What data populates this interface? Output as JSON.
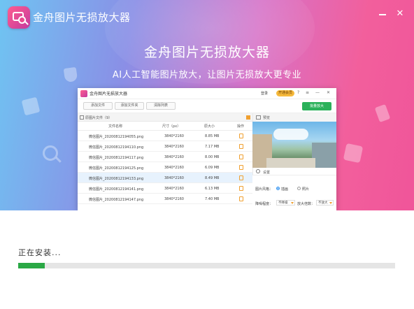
{
  "installer": {
    "app_title": "金舟图片无损放大器",
    "headline": "金舟图片无损放大器",
    "subline": "AI人工智能图片放大，让图片无损放大更专业",
    "minimize_icon": "minimize-icon",
    "close_icon": "close-icon",
    "close_glyph": "✕",
    "accent_color": "#2aa845"
  },
  "preview_app": {
    "title": "金舟图片无损放大器",
    "login": "登录",
    "vip": "开通会员",
    "window_controls": [
      "?",
      "≡",
      "—",
      "✕"
    ],
    "toolbar": {
      "add_file": "添加文件",
      "add_folder": "添加文件夹",
      "clear_list": "清除列表",
      "batch_enlarge": "批量放大"
    },
    "list_header": "原图片文件（9）",
    "columns": [
      "文件名称",
      "尺寸（px）",
      "原大小",
      "操作"
    ],
    "rows": [
      {
        "name": "微信图片_20200812194055.png",
        "size": "3840*2160",
        "filesize": "8.85 MB"
      },
      {
        "name": "微信图片_20200812194110.png",
        "size": "3840*2160",
        "filesize": "7.17 MB"
      },
      {
        "name": "微信图片_20200812194117.png",
        "size": "3840*2160",
        "filesize": "8.00 MB"
      },
      {
        "name": "微信图片_20200812194125.png",
        "size": "3840*2160",
        "filesize": "6.09 MB"
      },
      {
        "name": "微信图片_20200812194133.png",
        "size": "3840*2160",
        "filesize": "8.49 MB"
      },
      {
        "name": "微信图片_20200812194141.png",
        "size": "3840*2160",
        "filesize": "6.13 MB"
      },
      {
        "name": "微信图片_20200812194147.png",
        "size": "3840*2160",
        "filesize": "7.40 MB"
      }
    ],
    "selected_row": 4,
    "preview_label": "预览",
    "settings_label": "设置",
    "style_label": "图片风格：",
    "style_options": [
      "插画",
      "照片"
    ],
    "style_selected": "插画",
    "denoise_label": "降噪程度：",
    "denoise_value": "不降噪",
    "scale_label": "放大倍数：",
    "scale_value": "不放大"
  },
  "status": {
    "text": "正在安装...",
    "progress": 0.07
  }
}
